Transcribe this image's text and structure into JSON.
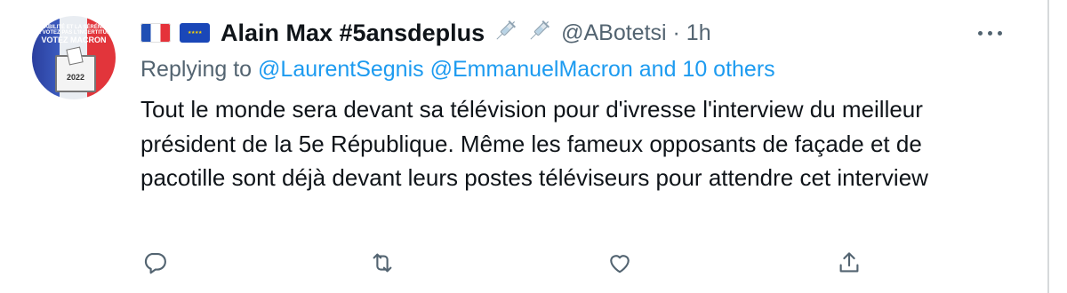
{
  "tweet": {
    "flags": [
      "france-flag-icon",
      "european-union-flag-icon"
    ],
    "display_name": "Alain Max #5ansdeplus",
    "name_emojis": [
      "syringe-icon",
      "syringe-icon"
    ],
    "handle_time": "@ABotetsi · 1h",
    "replying_prefix": "Replying to ",
    "replying_links": "@LaurentSegnis @EmmanuelMacron and 10 others",
    "text": "Tout le monde sera devant sa télévision pour d'ivresse l'interview du meilleur président de la 5e République. Même les fameux opposants de façade et de pacotille sont déjà devant leurs postes téléviseurs pour attendre cet interview",
    "avatar": {
      "line1": "STABILITÉ ET LA SÉRÉNITÉ",
      "line2": "NE VOTEZ PAS L'INCERTITUDE",
      "line3": "VOTEZ MACRON",
      "year": "2022"
    }
  },
  "actions": [
    {
      "name": "reply",
      "icon": "reply-icon"
    },
    {
      "name": "retweet",
      "icon": "retweet-icon"
    },
    {
      "name": "like",
      "icon": "heart-icon"
    },
    {
      "name": "share",
      "icon": "share-icon"
    }
  ],
  "colors": {
    "text": "#0f1419",
    "secondary": "#536471",
    "link": "#1d9bf0"
  }
}
